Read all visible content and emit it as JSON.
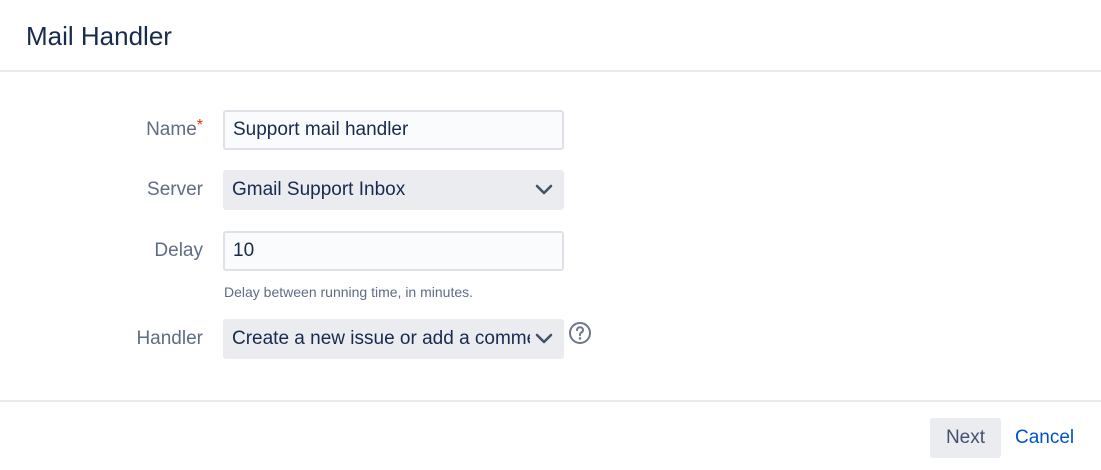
{
  "dialog": {
    "title": "Mail Handler"
  },
  "form": {
    "name": {
      "label": "Name",
      "required_mark": "*",
      "value": "Support mail handler"
    },
    "server": {
      "label": "Server",
      "selected": "Gmail Support Inbox"
    },
    "delay": {
      "label": "Delay",
      "value": "10",
      "description": "Delay between running time, in minutes."
    },
    "handler": {
      "label": "Handler",
      "selected": "Create a new issue or add a comment to an existing issue"
    }
  },
  "footer": {
    "next_label": "Next",
    "cancel_label": "Cancel"
  },
  "icons": {
    "dropdown": "chevron-down-icon",
    "help": "help-icon"
  },
  "colors": {
    "link": "#0052cc",
    "required": "#de350b",
    "text": "#172b4d",
    "label": "#5e6c84"
  }
}
